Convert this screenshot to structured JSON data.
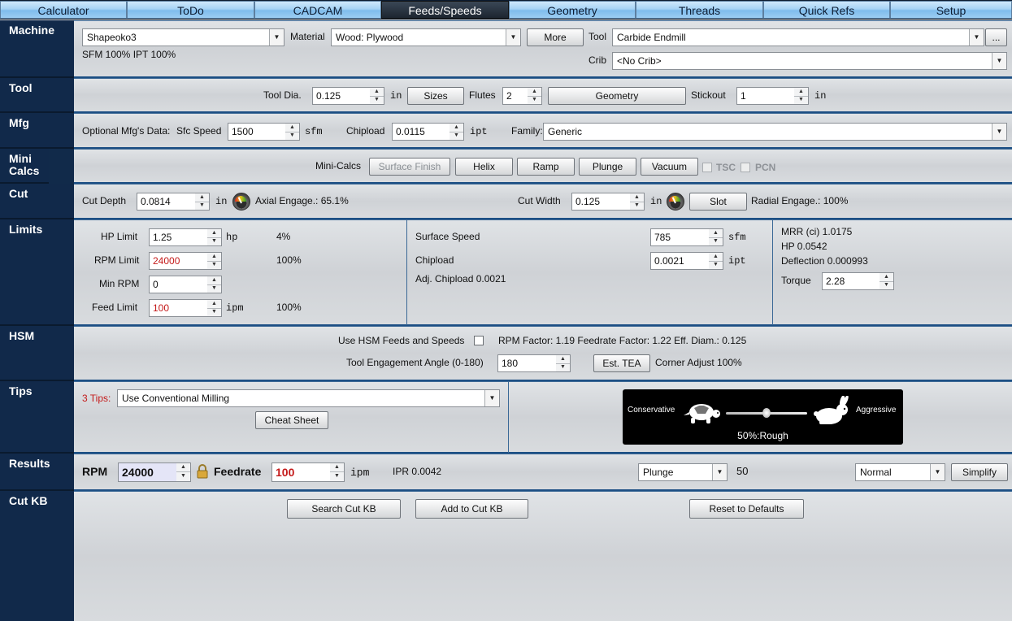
{
  "tabs": [
    "Calculator",
    "ToDo",
    "CADCAM",
    "Feeds/Speeds",
    "Geometry",
    "Threads",
    "Quick Refs",
    "Setup"
  ],
  "active_tab": "Feeds/Speeds",
  "sections": {
    "machine": "Machine",
    "tool": "Tool",
    "mfg": "Mfg",
    "mini_calcs": "Mini Calcs",
    "cut": "Cut",
    "limits": "Limits",
    "hsm": "HSM",
    "tips": "Tips",
    "results": "Results",
    "cut_kb": "Cut KB"
  },
  "machine": {
    "machine_value": "Shapeoko3",
    "material_label": "Material",
    "material_value": "Wood: Plywood",
    "more_button": "More",
    "tool_label": "Tool",
    "tool_value": "Carbide Endmill",
    "ellipsis_button": "...",
    "sfm_ipt": "SFM 100%  IPT 100%",
    "crib_label": "Crib",
    "crib_value": "<No Crib>"
  },
  "tool": {
    "dia_label": "Tool Dia.",
    "dia_value": "0.125",
    "dia_unit": "in",
    "sizes_button": "Sizes",
    "flutes_label": "Flutes",
    "flutes_value": "2",
    "geometry_button": "Geometry",
    "stickout_label": "Stickout",
    "stickout_value": "1",
    "stickout_unit": "in"
  },
  "mfg": {
    "optional_label": "Optional Mfg's Data:",
    "sfc_label": "Sfc Speed",
    "sfc_value": "1500",
    "sfc_unit": "sfm",
    "chipload_label": "Chipload",
    "chipload_value": "0.0115",
    "chipload_unit": "ipt",
    "family_label": "Family:",
    "family_value": "Generic"
  },
  "mini": {
    "label": "Mini-Calcs",
    "surface_finish": "Surface Finish",
    "helix": "Helix",
    "ramp": "Ramp",
    "plunge": "Plunge",
    "vacuum": "Vacuum",
    "tsc": "TSC",
    "pcn": "PCN"
  },
  "cut": {
    "depth_label": "Cut Depth",
    "depth_value": "0.0814",
    "depth_unit": "in",
    "axial": "Axial Engage.: 65.1%",
    "width_label": "Cut Width",
    "width_value": "0.125",
    "width_unit": "in",
    "slot_button": "Slot",
    "radial": "Radial Engage.: 100%"
  },
  "limits": {
    "hp_label": "HP Limit",
    "hp_value": "1.25",
    "hp_unit": "hp",
    "hp_pct": "4%",
    "rpm_label": "RPM Limit",
    "rpm_value": "24000",
    "rpm_pct": "100%",
    "minrpm_label": "Min RPM",
    "minrpm_value": "0",
    "feed_label": "Feed Limit",
    "feed_value": "100",
    "feed_unit": "ipm",
    "feed_pct": "100%",
    "surface_label": "Surface Speed",
    "surface_value": "785",
    "surface_unit": "sfm",
    "chipload_label": "Chipload",
    "chipload_value": "0.0021",
    "chipload_unit": "ipt",
    "adj_chipload": "Adj. Chipload 0.0021",
    "mrr": "MRR (ci) 1.0175",
    "hp": "HP 0.0542",
    "deflection": "Deflection 0.000993",
    "torque_label": "Torque",
    "torque_value": "2.28"
  },
  "hsm": {
    "use_label": "Use HSM Feeds and Speeds",
    "factors": "RPM Factor: 1.19   Feedrate Factor: 1.22   Eff. Diam.: 0.125",
    "tea_label": "Tool Engagement Angle (0-180)",
    "tea_value": "180",
    "est_tea_button": "Est. TEA",
    "corner": "Corner Adjust 100%"
  },
  "tips": {
    "count": "3 Tips:",
    "value": "Use Conventional Milling",
    "cheat_button": "Cheat Sheet",
    "conservative": "Conservative",
    "aggressive": "Aggressive",
    "slider_text": "50%:Rough",
    "slider_position": 0.5
  },
  "results": {
    "rpm_label": "RPM",
    "rpm_value": "24000",
    "feed_label": "Feedrate",
    "feed_value": "100",
    "feed_unit": "ipm",
    "ipr": "IPR 0.0042",
    "plunge_value": "Plunge",
    "plunge_number": "50",
    "mode_value": "Normal",
    "simplify_button": "Simplify"
  },
  "cutkb": {
    "search_button": "Search Cut KB",
    "add_button": "Add to Cut KB",
    "reset_button": "Reset to Defaults"
  }
}
